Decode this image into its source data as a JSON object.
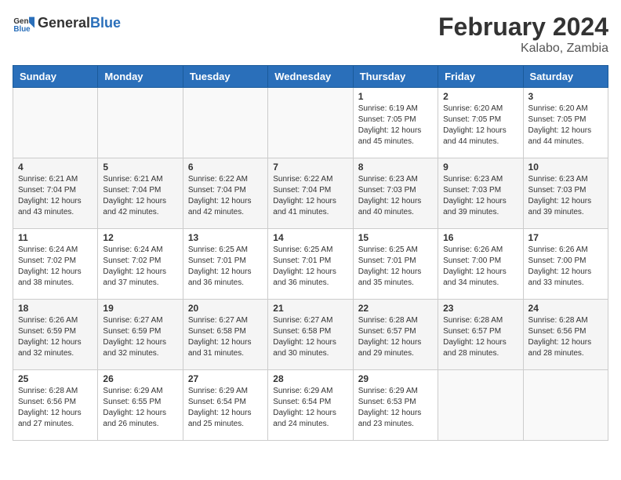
{
  "header": {
    "logo_general": "General",
    "logo_blue": "Blue",
    "month_year": "February 2024",
    "location": "Kalabo, Zambia"
  },
  "days_of_week": [
    "Sunday",
    "Monday",
    "Tuesday",
    "Wednesday",
    "Thursday",
    "Friday",
    "Saturday"
  ],
  "weeks": [
    [
      {
        "day": "",
        "info": ""
      },
      {
        "day": "",
        "info": ""
      },
      {
        "day": "",
        "info": ""
      },
      {
        "day": "",
        "info": ""
      },
      {
        "day": "1",
        "info": "Sunrise: 6:19 AM\nSunset: 7:05 PM\nDaylight: 12 hours and 45 minutes."
      },
      {
        "day": "2",
        "info": "Sunrise: 6:20 AM\nSunset: 7:05 PM\nDaylight: 12 hours and 44 minutes."
      },
      {
        "day": "3",
        "info": "Sunrise: 6:20 AM\nSunset: 7:05 PM\nDaylight: 12 hours and 44 minutes."
      }
    ],
    [
      {
        "day": "4",
        "info": "Sunrise: 6:21 AM\nSunset: 7:04 PM\nDaylight: 12 hours and 43 minutes."
      },
      {
        "day": "5",
        "info": "Sunrise: 6:21 AM\nSunset: 7:04 PM\nDaylight: 12 hours and 42 minutes."
      },
      {
        "day": "6",
        "info": "Sunrise: 6:22 AM\nSunset: 7:04 PM\nDaylight: 12 hours and 42 minutes."
      },
      {
        "day": "7",
        "info": "Sunrise: 6:22 AM\nSunset: 7:04 PM\nDaylight: 12 hours and 41 minutes."
      },
      {
        "day": "8",
        "info": "Sunrise: 6:23 AM\nSunset: 7:03 PM\nDaylight: 12 hours and 40 minutes."
      },
      {
        "day": "9",
        "info": "Sunrise: 6:23 AM\nSunset: 7:03 PM\nDaylight: 12 hours and 39 minutes."
      },
      {
        "day": "10",
        "info": "Sunrise: 6:23 AM\nSunset: 7:03 PM\nDaylight: 12 hours and 39 minutes."
      }
    ],
    [
      {
        "day": "11",
        "info": "Sunrise: 6:24 AM\nSunset: 7:02 PM\nDaylight: 12 hours and 38 minutes."
      },
      {
        "day": "12",
        "info": "Sunrise: 6:24 AM\nSunset: 7:02 PM\nDaylight: 12 hours and 37 minutes."
      },
      {
        "day": "13",
        "info": "Sunrise: 6:25 AM\nSunset: 7:01 PM\nDaylight: 12 hours and 36 minutes."
      },
      {
        "day": "14",
        "info": "Sunrise: 6:25 AM\nSunset: 7:01 PM\nDaylight: 12 hours and 36 minutes."
      },
      {
        "day": "15",
        "info": "Sunrise: 6:25 AM\nSunset: 7:01 PM\nDaylight: 12 hours and 35 minutes."
      },
      {
        "day": "16",
        "info": "Sunrise: 6:26 AM\nSunset: 7:00 PM\nDaylight: 12 hours and 34 minutes."
      },
      {
        "day": "17",
        "info": "Sunrise: 6:26 AM\nSunset: 7:00 PM\nDaylight: 12 hours and 33 minutes."
      }
    ],
    [
      {
        "day": "18",
        "info": "Sunrise: 6:26 AM\nSunset: 6:59 PM\nDaylight: 12 hours and 32 minutes."
      },
      {
        "day": "19",
        "info": "Sunrise: 6:27 AM\nSunset: 6:59 PM\nDaylight: 12 hours and 32 minutes."
      },
      {
        "day": "20",
        "info": "Sunrise: 6:27 AM\nSunset: 6:58 PM\nDaylight: 12 hours and 31 minutes."
      },
      {
        "day": "21",
        "info": "Sunrise: 6:27 AM\nSunset: 6:58 PM\nDaylight: 12 hours and 30 minutes."
      },
      {
        "day": "22",
        "info": "Sunrise: 6:28 AM\nSunset: 6:57 PM\nDaylight: 12 hours and 29 minutes."
      },
      {
        "day": "23",
        "info": "Sunrise: 6:28 AM\nSunset: 6:57 PM\nDaylight: 12 hours and 28 minutes."
      },
      {
        "day": "24",
        "info": "Sunrise: 6:28 AM\nSunset: 6:56 PM\nDaylight: 12 hours and 28 minutes."
      }
    ],
    [
      {
        "day": "25",
        "info": "Sunrise: 6:28 AM\nSunset: 6:56 PM\nDaylight: 12 hours and 27 minutes."
      },
      {
        "day": "26",
        "info": "Sunrise: 6:29 AM\nSunset: 6:55 PM\nDaylight: 12 hours and 26 minutes."
      },
      {
        "day": "27",
        "info": "Sunrise: 6:29 AM\nSunset: 6:54 PM\nDaylight: 12 hours and 25 minutes."
      },
      {
        "day": "28",
        "info": "Sunrise: 6:29 AM\nSunset: 6:54 PM\nDaylight: 12 hours and 24 minutes."
      },
      {
        "day": "29",
        "info": "Sunrise: 6:29 AM\nSunset: 6:53 PM\nDaylight: 12 hours and 23 minutes."
      },
      {
        "day": "",
        "info": ""
      },
      {
        "day": "",
        "info": ""
      }
    ]
  ]
}
